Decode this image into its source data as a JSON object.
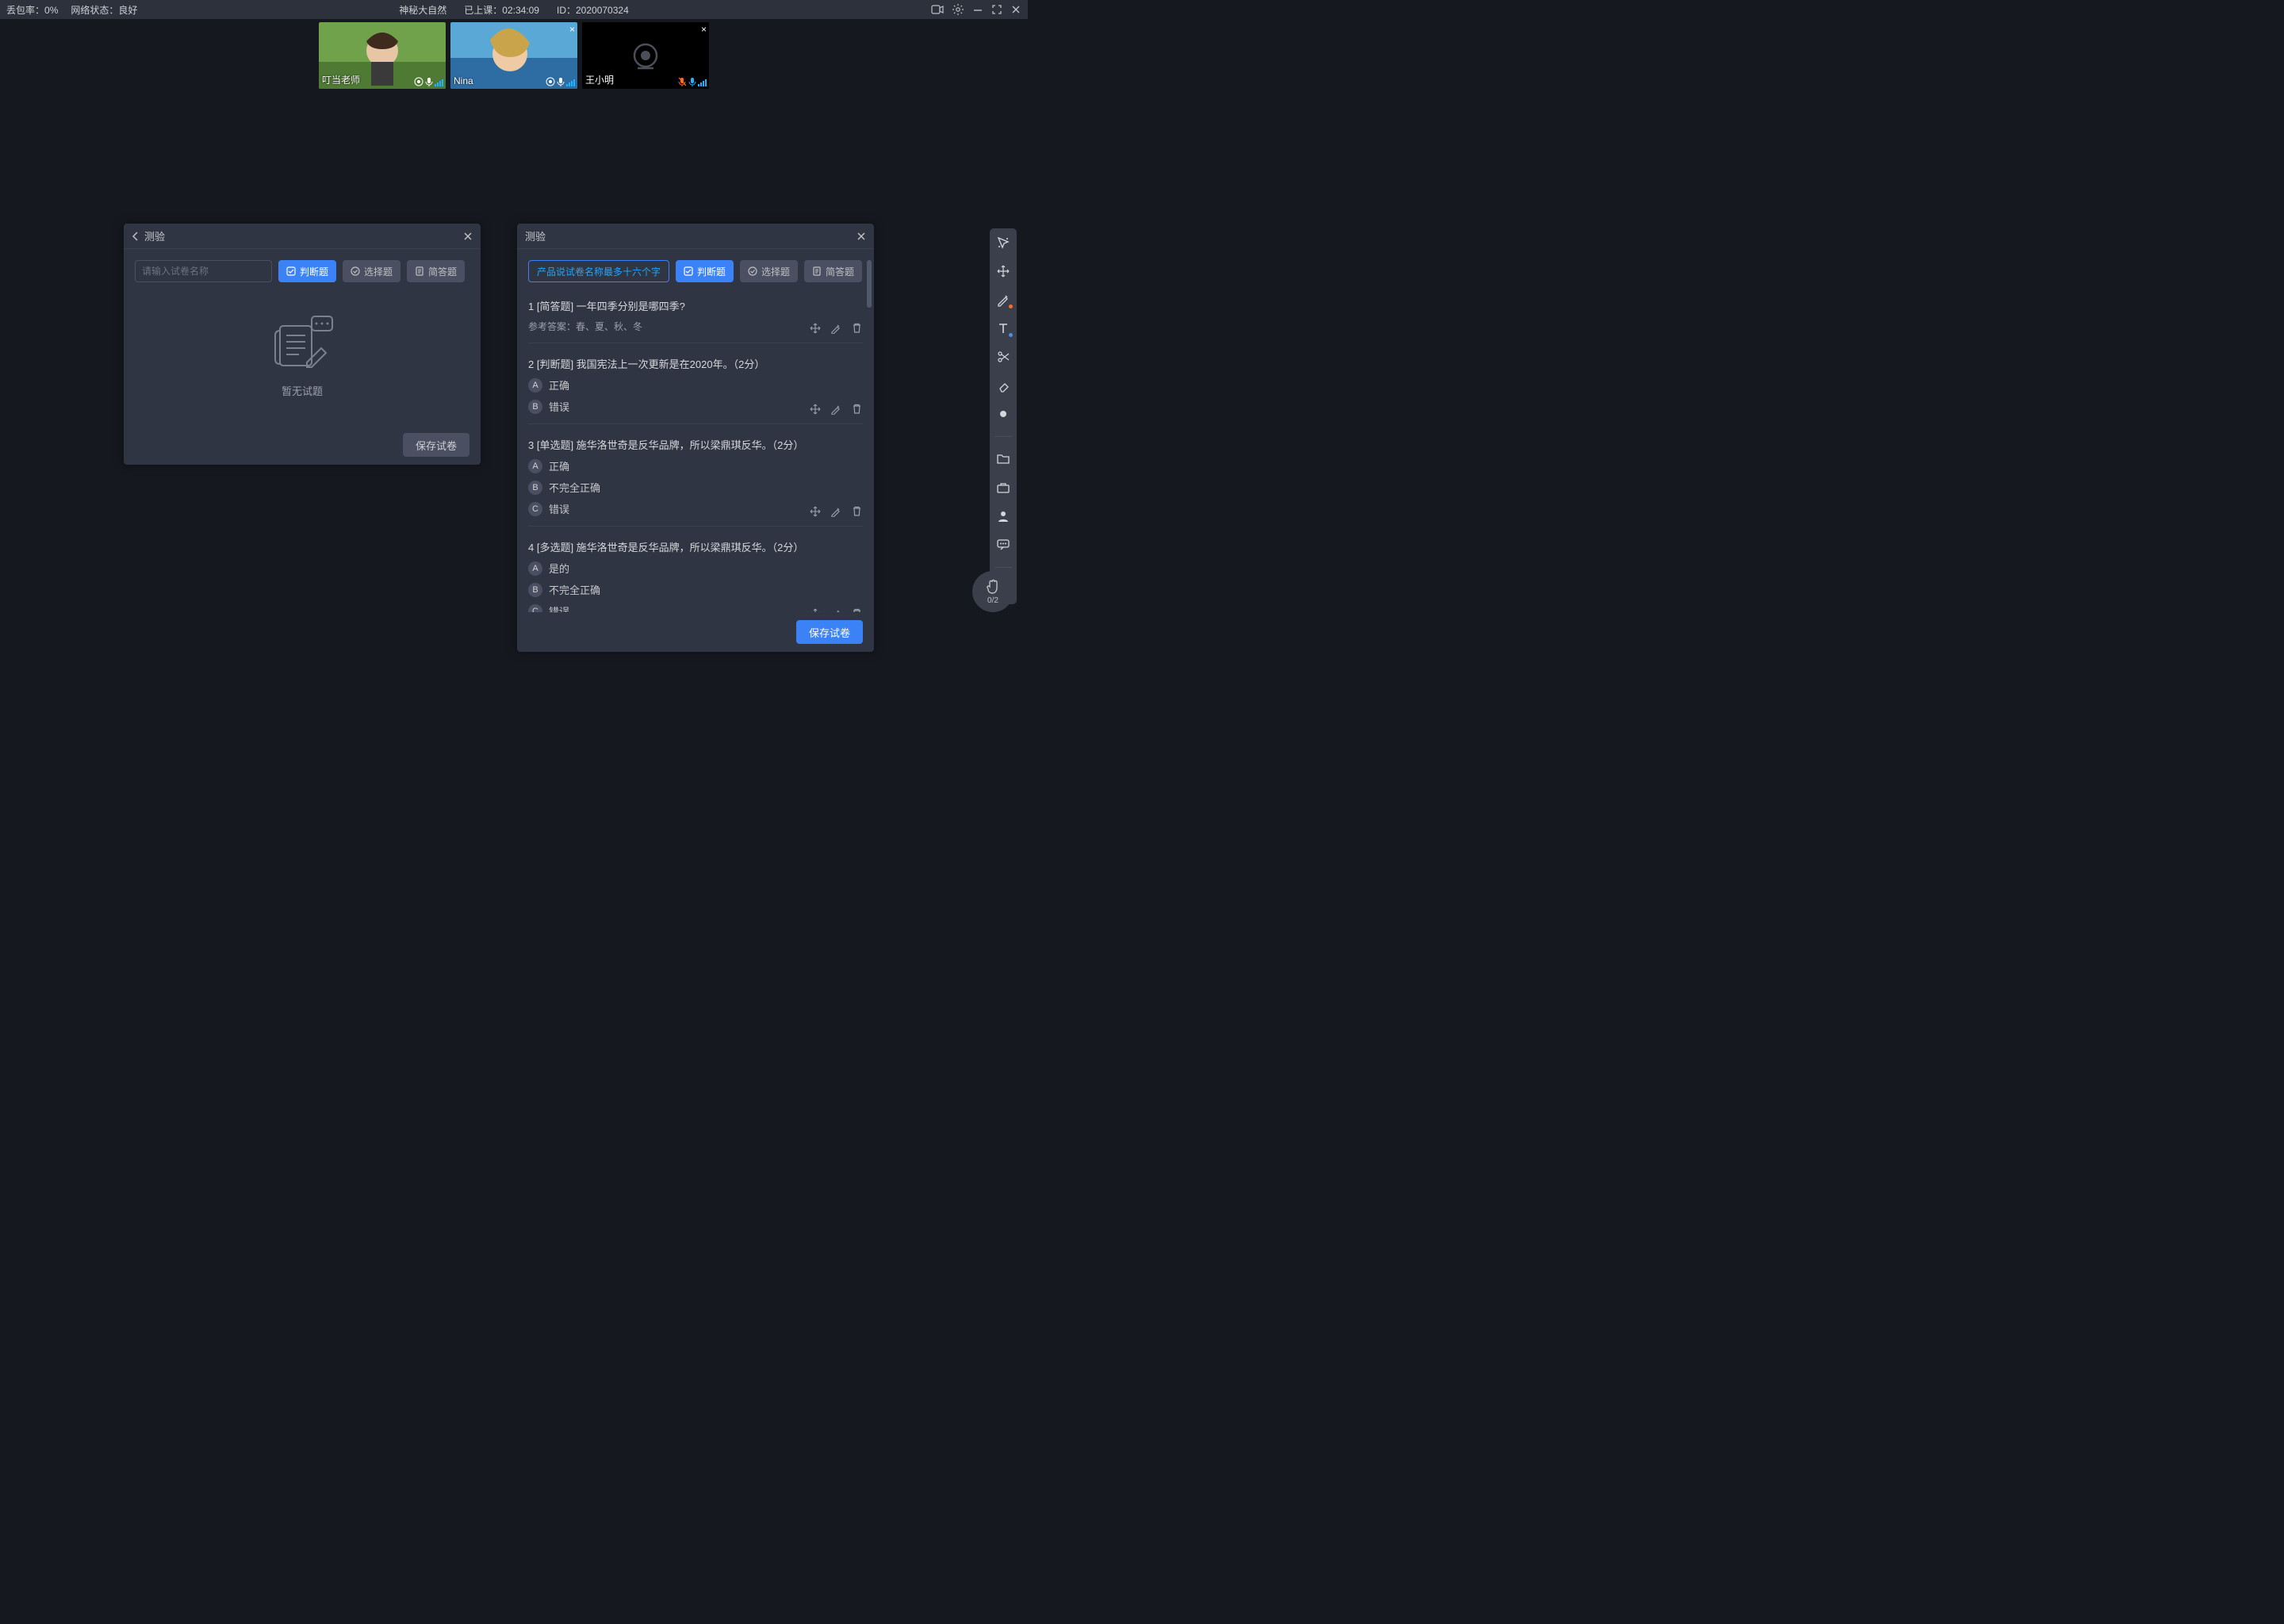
{
  "status": {
    "packet_loss_label": "丢包率：",
    "packet_loss_value": "0%",
    "net_label": "网络状态：",
    "net_value": "良好",
    "course_title": "神秘大自然",
    "elapsed_label": "已上课：",
    "elapsed_value": "02:34:09",
    "id_label": "ID：",
    "id_value": "2020070324"
  },
  "videos": [
    {
      "name": "叮当老师",
      "has_close": false,
      "muted": false,
      "camera_off": false
    },
    {
      "name": "Nina",
      "has_close": true,
      "muted": false,
      "camera_off": false
    },
    {
      "name": "王小明",
      "has_close": true,
      "muted": true,
      "camera_off": true
    }
  ],
  "hand": {
    "count": "0/2"
  },
  "panelA": {
    "title": "测验",
    "placeholder": "请输入试卷名称",
    "btn_judge": "判断题",
    "btn_choice": "选择题",
    "btn_short": "简答题",
    "empty": "暂无试题",
    "save": "保存试卷"
  },
  "panelB": {
    "title": "测验",
    "title_chip": "产品说试卷名称最多十六个字",
    "btn_judge": "判断题",
    "btn_choice": "选择题",
    "btn_short": "简答题",
    "save": "保存试卷",
    "questions": [
      {
        "head": "1 [简答题] 一年四季分别是哪四季?",
        "answer": "参考答案：春、夏、秋、冬",
        "options": []
      },
      {
        "head": "2 [判断题] 我国宪法上一次更新是在2020年。（2分）",
        "answer": "",
        "options": [
          {
            "k": "A",
            "t": "正确"
          },
          {
            "k": "B",
            "t": "错误"
          }
        ]
      },
      {
        "head": "3 [单选题] 施华洛世奇是反华品牌，所以梁鼎琪反华。（2分）",
        "answer": "",
        "options": [
          {
            "k": "A",
            "t": "正确"
          },
          {
            "k": "B",
            "t": "不完全正确"
          },
          {
            "k": "C",
            "t": "错误"
          }
        ]
      },
      {
        "head": "4 [多选题] 施华洛世奇是反华品牌，所以梁鼎琪反华。（2分）",
        "answer": "",
        "options": [
          {
            "k": "A",
            "t": "是的"
          },
          {
            "k": "B",
            "t": "不完全正确"
          },
          {
            "k": "C",
            "t": "错误"
          }
        ]
      }
    ]
  }
}
